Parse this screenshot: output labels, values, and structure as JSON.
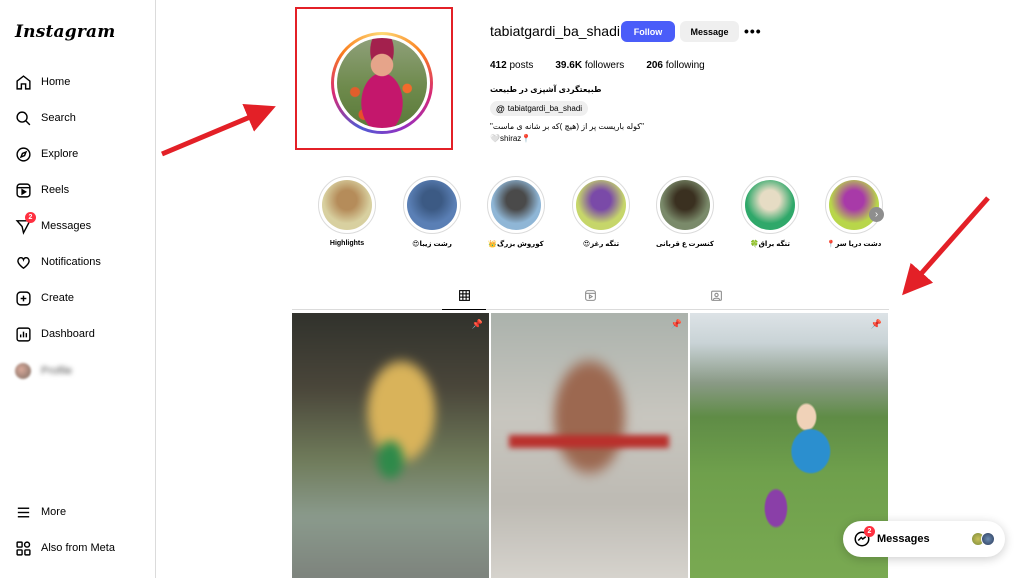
{
  "app": {
    "logo": "Instagram"
  },
  "sidebar": {
    "items": [
      {
        "label": "Home",
        "icon": "home-icon"
      },
      {
        "label": "Search",
        "icon": "search-icon"
      },
      {
        "label": "Explore",
        "icon": "compass-icon"
      },
      {
        "label": "Reels",
        "icon": "reels-icon"
      },
      {
        "label": "Messages",
        "icon": "messenger-icon",
        "badge": "2"
      },
      {
        "label": "Notifications",
        "icon": "heart-icon"
      },
      {
        "label": "Create",
        "icon": "plus-square-icon"
      },
      {
        "label": "Dashboard",
        "icon": "chart-icon"
      },
      {
        "label": "Profile",
        "icon": "avatar"
      }
    ],
    "bottom": [
      {
        "label": "More",
        "icon": "menu-icon"
      },
      {
        "label": "Also from Meta",
        "icon": "meta-grid-icon"
      }
    ]
  },
  "profile": {
    "username": "tabiatgardi_ba_shadi",
    "follow_label": "Follow",
    "message_label": "Message",
    "more_label": "•••",
    "stats": {
      "posts_count": "412",
      "posts_label": "posts",
      "followers_count": "39.6K",
      "followers_label": "followers",
      "following_count": "206",
      "following_label": "following"
    },
    "bio_name": "طبیعتگردی آشپزی در طبیعت",
    "threads_handle": "tabiatgardi_ba_shadi",
    "threads_icon": "@",
    "bio_line1": "\"کوله باریست پر از (هیچ )که بر شانه ی ماست\"",
    "bio_line2": "🤍shiraz📍"
  },
  "highlights": [
    {
      "label": "Highlights",
      "colors": [
        "#d8d0a0",
        "#b58c5a"
      ]
    },
    {
      "label": "رشت زیبا😍",
      "colors": [
        "#5a7fb5",
        "#3c5a84"
      ]
    },
    {
      "label": "کوروش بزرگ👑",
      "colors": [
        "#8fb6d6",
        "#4a4a4a"
      ]
    },
    {
      "label": "تنگه رغز😍",
      "colors": [
        "#c6d66a",
        "#7a4aa8"
      ]
    },
    {
      "label": "کنسرت ع قربانی",
      "colors": [
        "#7a8a6a",
        "#3a3020"
      ]
    },
    {
      "label": "تنگه براق🍀",
      "colors": [
        "#2fa86a",
        "#e6dcc4"
      ]
    },
    {
      "label": "دشت دریا سر📍",
      "colors": [
        "#b8d64a",
        "#a83aa8"
      ]
    }
  ],
  "tabs": [
    {
      "name": "posts",
      "icon": "grid-icon"
    },
    {
      "name": "reels",
      "icon": "reels-icon"
    },
    {
      "name": "tagged",
      "icon": "tagged-icon"
    }
  ],
  "floating_messages": {
    "label": "Messages",
    "badge": "2"
  }
}
